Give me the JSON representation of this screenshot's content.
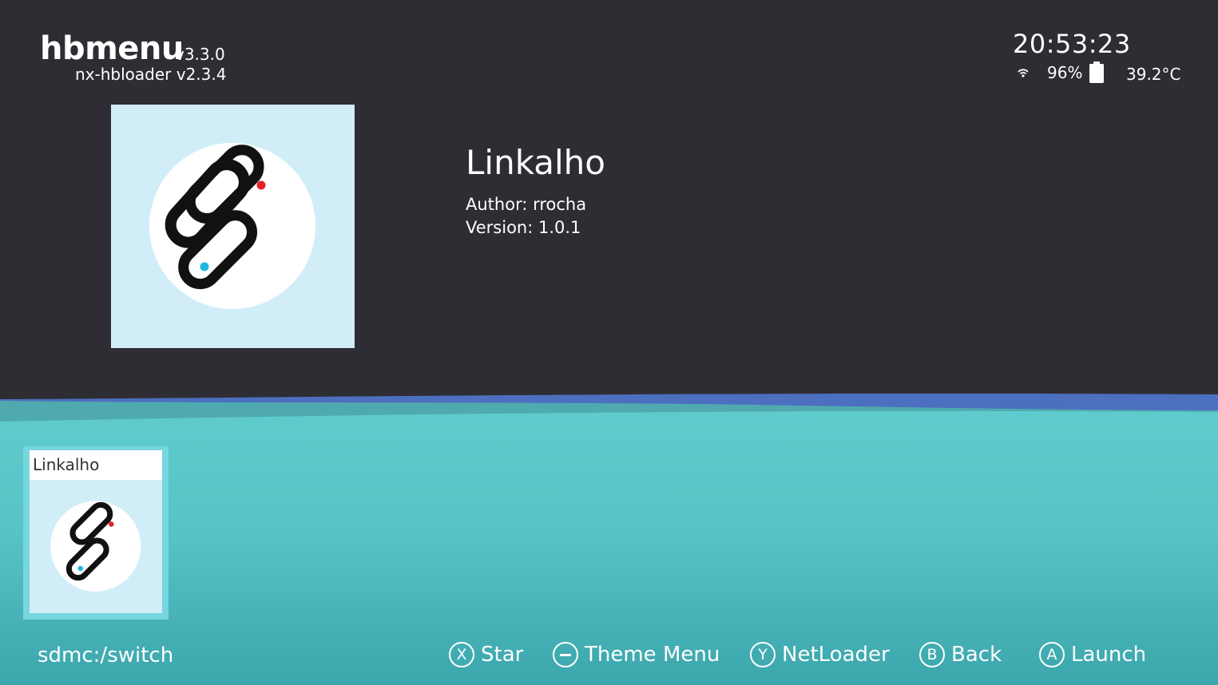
{
  "header": {
    "title": "hbmenu",
    "version": "v3.3.0",
    "loader": "nx-hbloader v2.3.4"
  },
  "status": {
    "time": "20:53:23",
    "battery_percent": "96%",
    "temperature": "39.2°C",
    "wifi_icon": "wifi-icon",
    "battery_icon": "battery-icon"
  },
  "selected_app": {
    "name": "Linkalho",
    "author": "Author: rrocha",
    "version": "Version: 1.0.1",
    "icon": "chain-link-icon"
  },
  "app_list": [
    {
      "title": "Linkalho",
      "icon": "chain-link-icon"
    }
  ],
  "footer": {
    "path": "sdmc:/switch",
    "hints": [
      {
        "button": "X",
        "label": "Star"
      },
      {
        "button": "−",
        "label": "Theme Menu"
      },
      {
        "button": "Y",
        "label": "NetLoader"
      },
      {
        "button": "B",
        "label": "Back"
      },
      {
        "button": "A",
        "label": "Launch"
      }
    ]
  },
  "colors": {
    "background_dark": "#2d2d33",
    "teal": "#5ecbcc",
    "teal_dark": "#3fa7ad",
    "blue_wave": "#4d6fbf",
    "icon_background": "#d1eef8",
    "chain_red_dot": "#e8202a",
    "chain_blue_dot": "#1fb8e0"
  }
}
